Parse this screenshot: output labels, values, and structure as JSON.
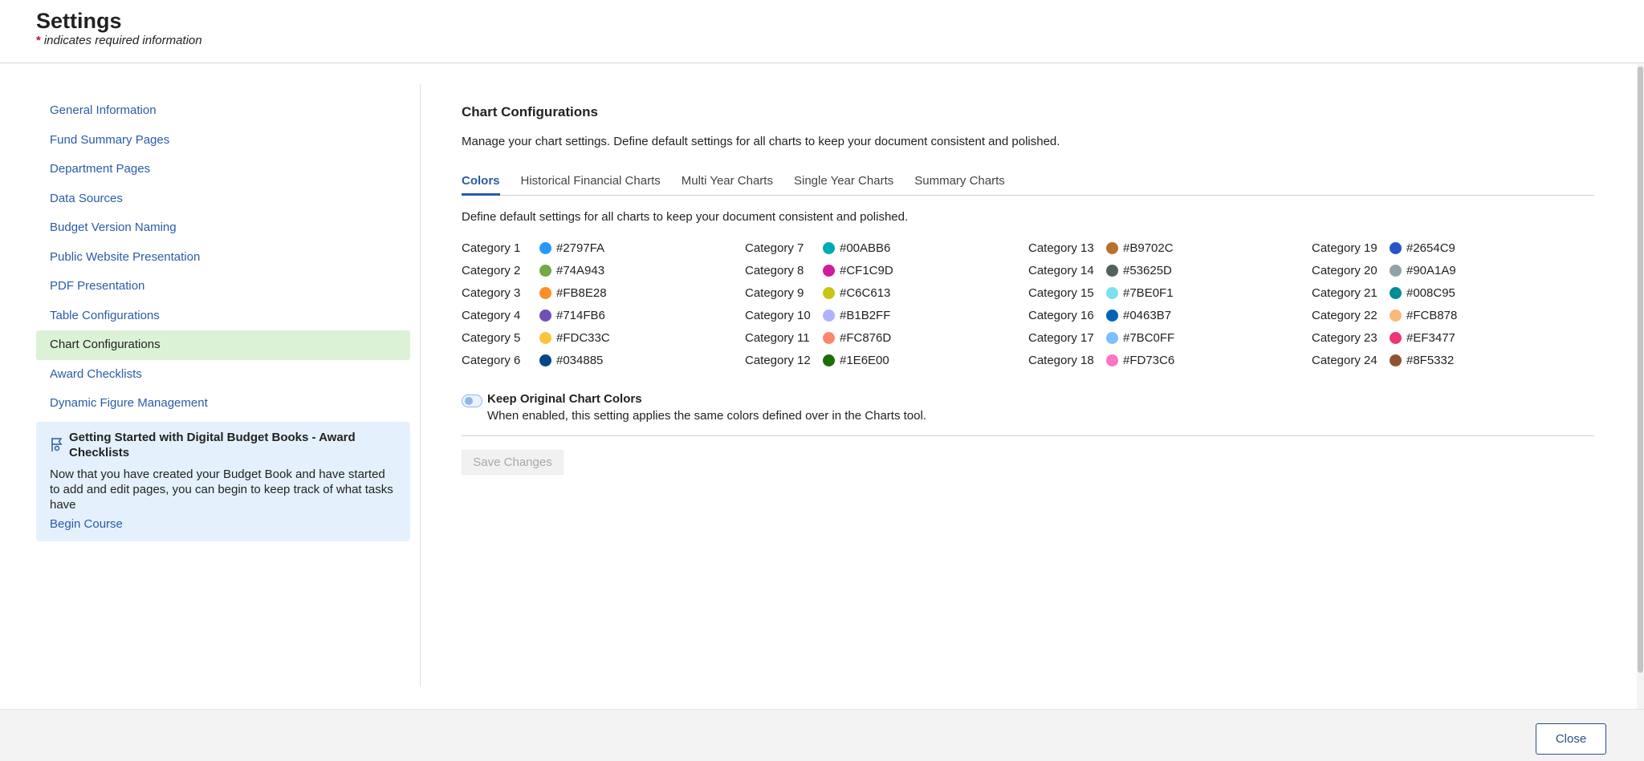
{
  "header": {
    "title": "Settings",
    "required_star": "*",
    "required_note": "indicates required information"
  },
  "sidebar": {
    "items": [
      {
        "label": "General Information"
      },
      {
        "label": "Fund Summary Pages"
      },
      {
        "label": "Department Pages"
      },
      {
        "label": "Data Sources"
      },
      {
        "label": "Budget Version Naming"
      },
      {
        "label": "Public Website Presentation"
      },
      {
        "label": "PDF Presentation"
      },
      {
        "label": "Table Configurations"
      },
      {
        "label": "Chart Configurations",
        "active": true
      },
      {
        "label": "Award Checklists"
      },
      {
        "label": "Dynamic Figure Management"
      }
    ],
    "course": {
      "icon": "course-flag-icon",
      "title": "Getting Started with Digital Budget Books - Award Checklists",
      "description": "Now that you have created your Budget Book and have started to add and edit pages, you can begin to keep track of what tasks have",
      "link": "Begin Course"
    }
  },
  "main": {
    "title": "Chart Configurations",
    "description": "Manage your chart settings. Define default settings for all charts to keep your document consistent and polished.",
    "tabs": [
      {
        "label": "Colors",
        "active": true
      },
      {
        "label": "Historical Financial Charts"
      },
      {
        "label": "Multi Year Charts"
      },
      {
        "label": "Single Year Charts"
      },
      {
        "label": "Summary Charts"
      }
    ],
    "tab_description": "Define default settings for all charts to keep your document consistent and polished.",
    "categories": [
      {
        "label": "Category 1",
        "hex": "#2797FA"
      },
      {
        "label": "Category 2",
        "hex": "#74A943"
      },
      {
        "label": "Category 3",
        "hex": "#FB8E28"
      },
      {
        "label": "Category 4",
        "hex": "#714FB6"
      },
      {
        "label": "Category 5",
        "hex": "#FDC33C"
      },
      {
        "label": "Category 6",
        "hex": "#034885"
      },
      {
        "label": "Category 7",
        "hex": "#00ABB6"
      },
      {
        "label": "Category 8",
        "hex": "#CF1C9D"
      },
      {
        "label": "Category 9",
        "hex": "#C6C613"
      },
      {
        "label": "Category 10",
        "hex": "#B1B2FF"
      },
      {
        "label": "Category 11",
        "hex": "#FC876D"
      },
      {
        "label": "Category 12",
        "hex": "#1E6E00"
      },
      {
        "label": "Category 13",
        "hex": "#B9702C"
      },
      {
        "label": "Category 14",
        "hex": "#53625D"
      },
      {
        "label": "Category 15",
        "hex": "#7BE0F1"
      },
      {
        "label": "Category 16",
        "hex": "#0463B7"
      },
      {
        "label": "Category 17",
        "hex": "#7BC0FF"
      },
      {
        "label": "Category 18",
        "hex": "#FD73C6"
      },
      {
        "label": "Category 19",
        "hex": "#2654C9"
      },
      {
        "label": "Category 20",
        "hex": "#90A1A9"
      },
      {
        "label": "Category 21",
        "hex": "#008C95"
      },
      {
        "label": "Category 22",
        "hex": "#FCB878"
      },
      {
        "label": "Category 23",
        "hex": "#EF3477"
      },
      {
        "label": "Category 24",
        "hex": "#8F5332"
      }
    ],
    "keep_original": {
      "label": "Keep Original Chart Colors",
      "description": "When enabled, this setting applies the same colors defined over in the Charts tool.",
      "enabled": false
    },
    "save_label": "Save Changes"
  },
  "footer": {
    "close_label": "Close"
  },
  "colors": {
    "link": "#2a5ba8",
    "active_nav_bg": "#dcf2d6",
    "course_bg": "#e4f1fc"
  }
}
